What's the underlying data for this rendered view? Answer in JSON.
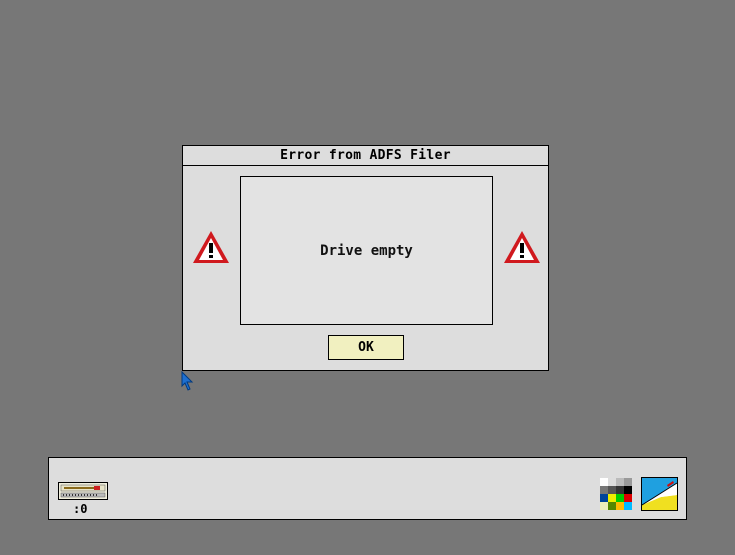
{
  "dialog": {
    "title": "Error from ADFS Filer",
    "message": "Drive empty",
    "ok_label": "OK"
  },
  "iconbar": {
    "drive_label": ":0"
  },
  "icons": {
    "warning": "warning-triangle-icon",
    "drive": "floppy-drive-icon",
    "palette": "palette-icon",
    "draw": "draw-app-icon"
  },
  "colors": {
    "desktop": "#777777",
    "window": "#dddddd",
    "button": "#f1f0c0",
    "warning_red": "#d0191e"
  }
}
